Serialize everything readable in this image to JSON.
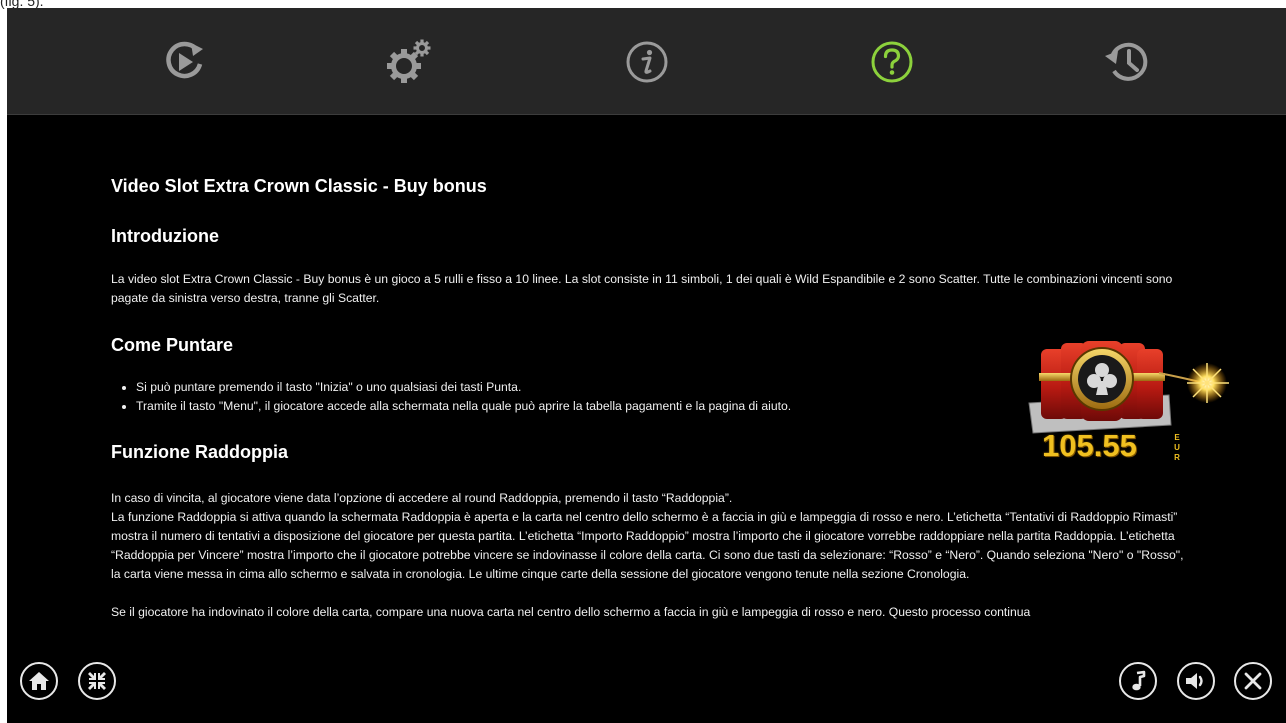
{
  "page_caption": "(fig. 5).",
  "colors": {
    "topbar_bg": "#262626",
    "help_tab_accent": "#8cd13c",
    "icon_gray": "#9a9a9a",
    "content_bg": "#000000",
    "text": "#f0f0f0",
    "amount_gold": "#f0c020"
  },
  "tabs": [
    {
      "icon": "autoplay-icon",
      "active": false
    },
    {
      "icon": "settings-gears-icon",
      "active": false
    },
    {
      "icon": "info-icon",
      "active": false
    },
    {
      "icon": "help-question-icon",
      "active": true
    },
    {
      "icon": "history-icon",
      "active": false
    }
  ],
  "help": {
    "title": "Video Slot Extra Crown Classic - Buy bonus",
    "intro": {
      "heading": "Introduzione",
      "text": "La video slot Extra Crown Classic - Buy bonus è un gioco a 5 rulli e fisso a 10 linee. La slot consiste in 11 simboli, 1 dei quali è Wild Espandibile e 2 sono Scatter. Tutte le combinazioni vincenti sono pagate da sinistra verso destra, tranne gli Scatter."
    },
    "bet": {
      "heading": "Come Puntare",
      "bullets": [
        "Si può puntare premendo il tasto \"Inizia\" o uno qualsiasi dei tasti Punta.",
        "Tramite il tasto \"Menu\", il giocatore accede alla schermata nella quale può aprire la tabella pagamenti e la pagina di aiuto."
      ]
    },
    "double": {
      "heading": "Funzione Raddoppia",
      "p1": "In caso di vincita, al giocatore viene data l’opzione di accedere al round Raddoppia, premendo il tasto “Raddoppia”.",
      "p2": "La funzione Raddoppia si attiva quando la schermata Raddoppia è aperta e la carta nel centro dello schermo è a faccia in giù e lampeggia di rosso e nero. L’etichetta “Tentativi di Raddoppio Rimasti” mostra il numero di tentativi a disposizione del giocatore per questa partita. L’etichetta “Importo Raddoppio” mostra l’importo che il giocatore vorrebbe raddoppiare nella partita Raddoppia. L’etichetta “Raddoppia per Vincere” mostra l’importo che il giocatore potrebbe vincere se indovinasse il colore della carta. Ci sono due tasti da selezionare: “Rosso” e “Nero”. Quando seleziona \"Nero\" o \"Rosso\", la carta viene messa in cima allo schermo e salvata in cronologia. Le ultime cinque carte della sessione del giocatore vengono tenute nella sezione Cronologia.",
      "p3": "Se il giocatore ha indovinato il colore della carta, compare una nuova carta nel centro dello schermo a faccia in giù e lampeggia di rosso e nero. Questo processo continua"
    }
  },
  "dynamite_jackpot": {
    "amount": "105.55",
    "currency_letters": [
      "E",
      "U",
      "R"
    ]
  },
  "bottom_left_buttons": [
    {
      "icon": "home-icon"
    },
    {
      "icon": "minimize-icon"
    }
  ],
  "bottom_right_buttons": [
    {
      "icon": "music-note-icon"
    },
    {
      "icon": "sound-icon"
    },
    {
      "icon": "close-icon"
    }
  ]
}
